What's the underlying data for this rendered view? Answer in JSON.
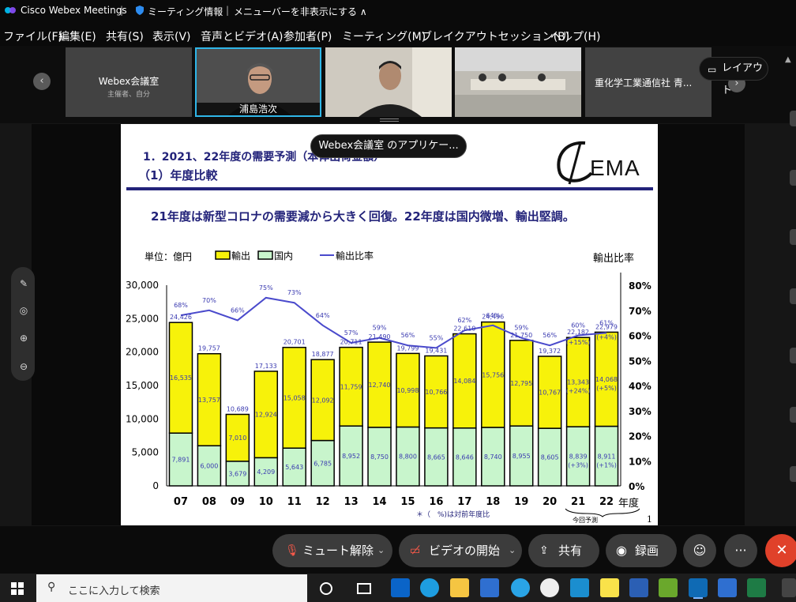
{
  "titlebar": {
    "app_title": "Cisco Webex Meetings",
    "sep": "|",
    "meeting_info": "ミーティング情報",
    "hide_menu": "メニューバーを非表示にする ∧"
  },
  "menus": [
    "ファイル(F)",
    "編集(E)",
    "共有(S)",
    "表示(V)",
    "音声とビデオ(A)",
    "参加者(P)",
    "ミーティング(M)",
    "ブレイクアウトセッション(B)",
    "ヘルプ(H)"
  ],
  "participants": {
    "room_name": "Webex会議室",
    "room_sub": "主催者、自分",
    "person_name": "浦島浩次",
    "partial_name": "重化学工業通信社 青..."
  },
  "layout_button": "レイアウト",
  "tooltip": "Webex会議室 のアプリケー...",
  "slide": {
    "section_title": "1．2021、22年度の需要予測（本体出荷金額）",
    "sub_title": "（1）年度比較",
    "logo_text": "EMA",
    "headline": "21年度は新型コロナの需要減から大きく回復。22年度は国内微増、輸出堅調。",
    "unit_label": "単位：億円",
    "right_axis_label": "輸出比率",
    "note": "＊（　%)は対前年度比",
    "page_num": "1",
    "forecast_label": "今回予測"
  },
  "chart_data": {
    "type": "bar",
    "stacked": true,
    "categories": [
      "07",
      "08",
      "09",
      "10",
      "11",
      "12",
      "13",
      "14",
      "15",
      "16",
      "17",
      "18",
      "19",
      "20",
      "21",
      "22"
    ],
    "xlabel_suffix": "年度",
    "series": [
      {
        "name": "国内",
        "color": "#c8f5cc",
        "values": [
          7891,
          6000,
          3679,
          4209,
          5643,
          6785,
          8952,
          8750,
          8800,
          8665,
          8646,
          8740,
          8955,
          8605,
          8839,
          8911
        ]
      },
      {
        "name": "輸出",
        "color": "#f7f20a",
        "values": [
          16535,
          13757,
          7010,
          12924,
          15058,
          12092,
          11759,
          12740,
          10998,
          10766,
          14084,
          15756,
          12795,
          10767,
          13343,
          14068
        ]
      },
      {
        "name": "輸出比率",
        "type": "line",
        "color": "#4a4acc",
        "values": [
          68,
          70,
          66,
          75,
          73,
          64,
          57,
          59,
          56,
          55,
          62,
          64,
          59,
          56,
          60,
          61
        ]
      }
    ],
    "totals": [
      24426,
      19757,
      10689,
      17133,
      20701,
      18877,
      20711,
      21490,
      19799,
      19431,
      22610,
      24496,
      21750,
      19372,
      22182,
      22979
    ],
    "ratio_labels": [
      "68%",
      "70%",
      "66%",
      "75%",
      "73%",
      "64%",
      "57%",
      "59%",
      "56%",
      "55%",
      "62%",
      "64%",
      "59%",
      "56%",
      "60%",
      "61%"
    ],
    "domestic_labels": [
      "7,891",
      "6,000",
      "3,679",
      "4,209",
      "5,643",
      "6,785",
      "8,952",
      "8,750",
      "8,800",
      "8,665",
      "8,646",
      "8,740",
      "8,955",
      "8,605",
      "8,839",
      "8,911"
    ],
    "export_labels": [
      "16,535",
      "13,757",
      "7,010",
      "12,924",
      "15,058",
      "12,092",
      "11,759",
      "12,740",
      "10,998",
      "10,766",
      "14,084",
      "15,756",
      "12,795",
      "10,767",
      "13,343",
      "14,068"
    ],
    "total_labels": [
      "24,426",
      "19,757",
      "10,689",
      "17,133",
      "20,701",
      "18,877",
      "20,711",
      "21,490",
      "19,799",
      "19,431",
      "22,610",
      "24,496",
      "21,750",
      "19,372",
      "22,182",
      "22,979"
    ],
    "yoy_total": {
      "21": "(+15%)",
      "22": "(+4%)"
    },
    "yoy_export": {
      "21": "(+24%)",
      "22": "(+5%)"
    },
    "yoy_domestic": {
      "21": "(+3%)",
      "22": "(+1%)"
    },
    "ylim": [
      0,
      30000
    ],
    "y_ticks": [
      "0",
      "5,000",
      "10,000",
      "15,000",
      "20,000",
      "25,000",
      "30,000"
    ],
    "y2lim": [
      0,
      80
    ],
    "y2_ticks": [
      "0%",
      "10%",
      "20%",
      "30%",
      "40%",
      "50%",
      "60%",
      "70%",
      "80%"
    ]
  },
  "controls": {
    "mute": "ミュート解除",
    "video": "ビデオの開始",
    "share": "共有",
    "record": "録画"
  },
  "taskbar": {
    "search_placeholder": "ここに入力して検索"
  },
  "colors": {
    "accent_blue": "#00a0d1",
    "end_red": "#e0412a"
  }
}
